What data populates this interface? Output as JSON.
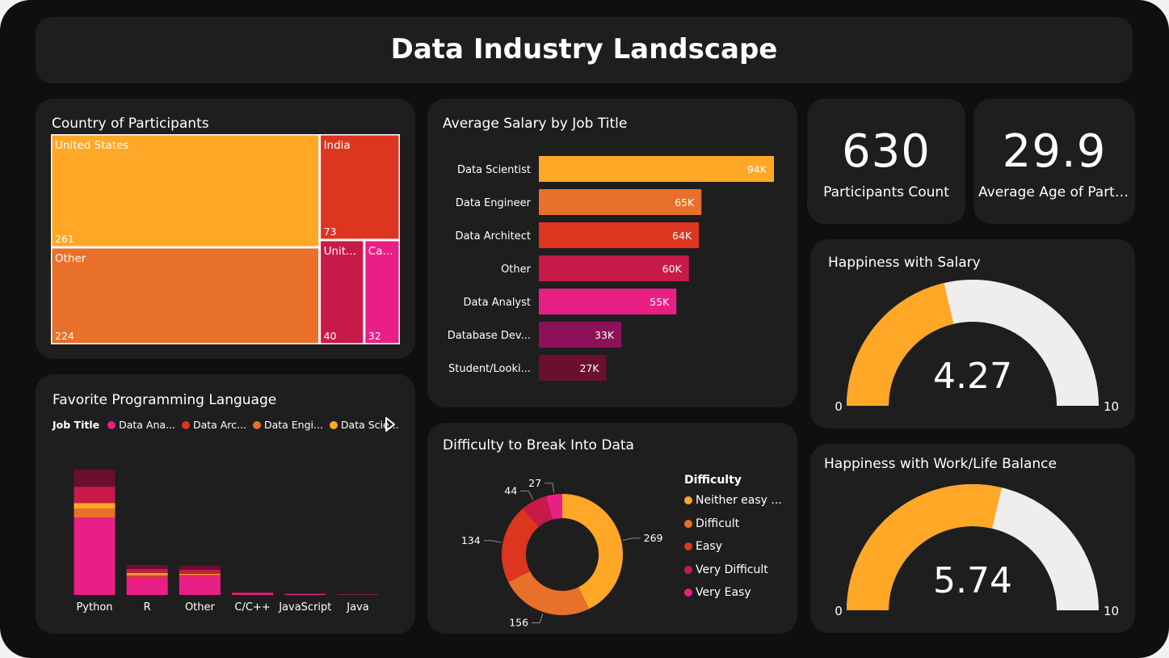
{
  "header": {
    "title": "Data Industry Landscape"
  },
  "colors": {
    "orange_light": "#ffa726",
    "orange": "#e8702a",
    "red": "#dc3520",
    "crimson": "#c81a48",
    "pink": "#ea1f86",
    "magenta_dark": "#8b1258",
    "maroon": "#6a0f2e",
    "gauge_bg": "#efeeec"
  },
  "treemap": {
    "title": "Country of Participants",
    "chart_data": {
      "type": "treemap",
      "items": [
        {
          "label": "United States",
          "value": 261
        },
        {
          "label": "Other",
          "value": 224
        },
        {
          "label": "India",
          "value": 73
        },
        {
          "label": "Unit...",
          "value": 40
        },
        {
          "label": "Ca...",
          "value": 32
        }
      ]
    }
  },
  "salary": {
    "title": "Average Salary by Job Title",
    "chart_data": {
      "type": "bar",
      "orientation": "horizontal",
      "categories": [
        "Data Scientist",
        "Data Engineer",
        "Data Architect",
        "Other",
        "Data Analyst",
        "Database Dev...",
        "Student/Looki..."
      ],
      "values": [
        94,
        65,
        64,
        60,
        55,
        33,
        27
      ],
      "labels": [
        "94K",
        "65K",
        "64K",
        "60K",
        "55K",
        "33K",
        "27K"
      ],
      "unit": "K"
    }
  },
  "kpis": [
    {
      "value": "630",
      "label": "Participants Count"
    },
    {
      "value": "29.9",
      "label": "Average Age of Particip..."
    }
  ],
  "gauge_salary": {
    "title": "Happiness with Salary",
    "chart_data": {
      "type": "gauge",
      "value": 4.27,
      "min": 0,
      "max": 10
    },
    "value_label": "4.27",
    "min_label": "0",
    "max_label": "10"
  },
  "gauge_balance": {
    "title": "Happiness with Work/Life Balance",
    "chart_data": {
      "type": "gauge",
      "value": 5.74,
      "min": 0,
      "max": 10
    },
    "value_label": "5.74",
    "min_label": "0",
    "max_label": "10"
  },
  "languages": {
    "title": "Favorite Programming Language",
    "legend_title": "Job Title",
    "legend": [
      "Data Ana...",
      "Data Arc...",
      "Data Engi...",
      "Data Scie..."
    ],
    "chart_data": {
      "type": "bar",
      "stacked": true,
      "categories": [
        "Python",
        "R",
        "Other",
        "C/C++",
        "JavaScript",
        "Java"
      ],
      "series": [
        {
          "name": "Data Ana...",
          "values": [
            95,
            22,
            23,
            2,
            1,
            0.5
          ]
        },
        {
          "name": "Data Arc...",
          "values": [
            0,
            1,
            1,
            0,
            0,
            0
          ]
        },
        {
          "name": "Data Engi...",
          "values": [
            11,
            2,
            1,
            0,
            0,
            0
          ]
        },
        {
          "name": "Data Scie...",
          "values": [
            7,
            2,
            1,
            0,
            0,
            0
          ]
        },
        {
          "name": "",
          "values": [
            20,
            5,
            5,
            1,
            0.5,
            0
          ]
        },
        {
          "name": "",
          "values": [
            21,
            5,
            5,
            0,
            0,
            0
          ]
        }
      ]
    }
  },
  "difficulty": {
    "title": "Difficulty to Break Into Data",
    "legend_title": "Difficulty",
    "chart_data": {
      "type": "pie",
      "donut": true,
      "categories": [
        "Neither easy ...",
        "Difficult",
        "Easy",
        "Very Difficult",
        "Very Easy"
      ],
      "values": [
        269,
        156,
        134,
        44,
        27
      ]
    }
  }
}
